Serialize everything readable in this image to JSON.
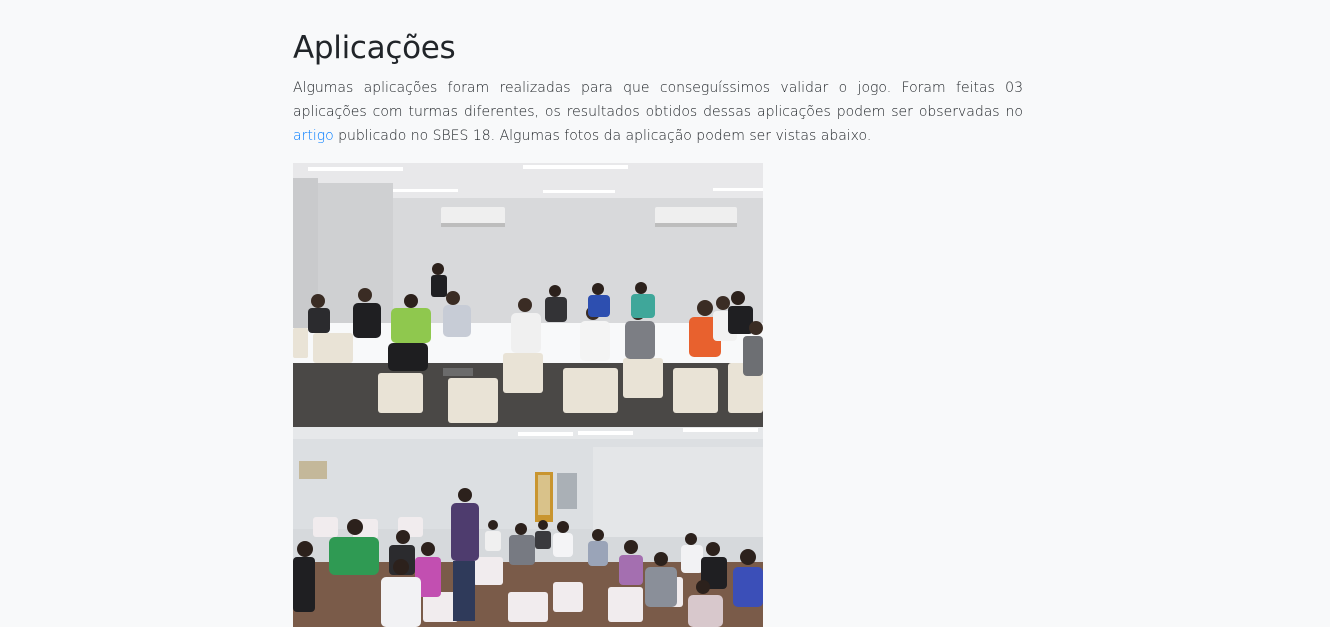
{
  "section": {
    "title": "Aplicações",
    "text_before_link": "Algumas aplicações foram realizadas para que conseguíssimos validar o jogo. Foram feitas 03 aplicações com turmas diferentes, os resultados obtidos dessas aplicações podem ser observadas no ",
    "link_label": "artigo",
    "text_after_link": " publicado no SBES 18. Algumas fotos da aplicação podem ser vistas abaixo."
  },
  "colors": {
    "page_background": "#f8f9fa",
    "text": "#212529",
    "link": "#007bff"
  }
}
